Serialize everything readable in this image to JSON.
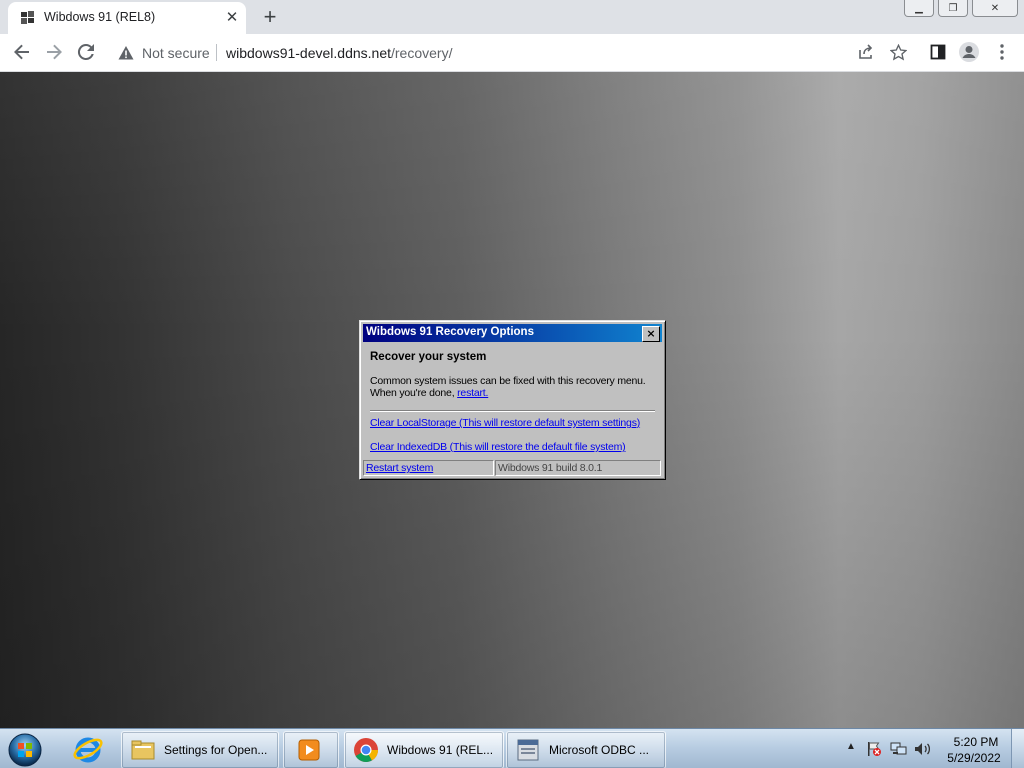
{
  "browser": {
    "tab_title": "Wibdows 91 (REL8)",
    "security_label": "Not secure",
    "url_host": "wibdows91-devel.ddns.net",
    "url_path": "/recovery/"
  },
  "dialog": {
    "title": "Wibdows 91 Recovery Options",
    "close_label": "×",
    "heading": "Recover your system",
    "description_line1": "Common system issues can be fixed with this recovery menu.",
    "description_line2_prefix": "When you're done, ",
    "restart_link": "restart.",
    "clear_localstorage_link": "Clear LocalStorage (This will restore default system settings)",
    "clear_indexeddb_link": "Clear IndexedDB (This will restore the default file system)",
    "restart_system_link": "Restart system",
    "build_label": "Wibdows 91 build 8.0.1"
  },
  "taskbar": {
    "items": [
      {
        "label": "Settings for Open..."
      },
      {
        "label": "Wibdows 91 (REL..."
      },
      {
        "label": "Microsoft ODBC ..."
      }
    ],
    "clock_time": "5:20 PM",
    "clock_date": "5/29/2022"
  },
  "icons": {
    "back": "back-arrow-icon",
    "forward": "forward-arrow-icon",
    "reload": "reload-icon",
    "warning": "warning-icon",
    "share": "share-icon",
    "bookmark": "star-icon",
    "sidepanel": "side-panel-icon",
    "profile": "profile-icon",
    "menu": "kebab-menu-icon"
  }
}
